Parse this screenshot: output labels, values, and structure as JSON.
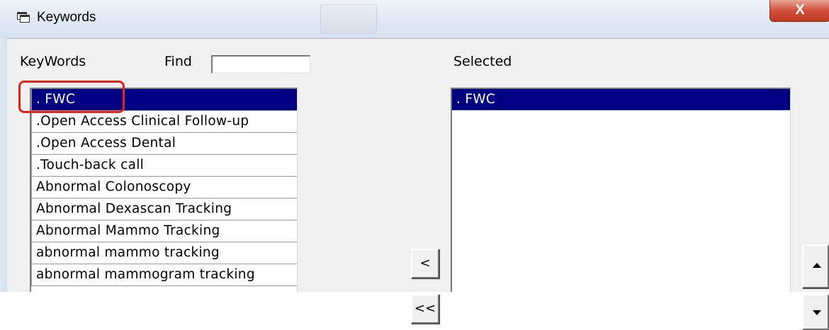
{
  "window": {
    "title": "Keywords",
    "close_glyph": "X",
    "title_icon": "window-icon"
  },
  "keywords_panel": {
    "label": "KeyWords",
    "find_label": "Find",
    "find_value": "",
    "items": [
      {
        "label": ". FWC",
        "selected": true
      },
      {
        "label": ".Open Access Clinical Follow-up",
        "selected": false
      },
      {
        "label": ".Open Access Dental",
        "selected": false
      },
      {
        "label": ".Touch-back call",
        "selected": false
      },
      {
        "label": "Abnormal Colonoscopy",
        "selected": false
      },
      {
        "label": "Abnormal Dexascan Tracking",
        "selected": false
      },
      {
        "label": "Abnormal Mammo Tracking",
        "selected": false
      },
      {
        "label": "abnormal mammo tracking",
        "selected": false
      },
      {
        "label": "abnormal mammogram tracking",
        "selected": false
      }
    ]
  },
  "selected_panel": {
    "label": "Selected",
    "items": [
      {
        "label": ". FWC",
        "selected": true
      }
    ]
  },
  "buttons": {
    "remove_label": "<",
    "remove_all_label": "<<",
    "move_up_icon": "triangle-up-icon",
    "move_down_icon": "triangle-down-icon"
  },
  "colors": {
    "selection": "#000080",
    "highlight_annotation": "#e2231a",
    "dialog_background": "#f0f0f0"
  }
}
